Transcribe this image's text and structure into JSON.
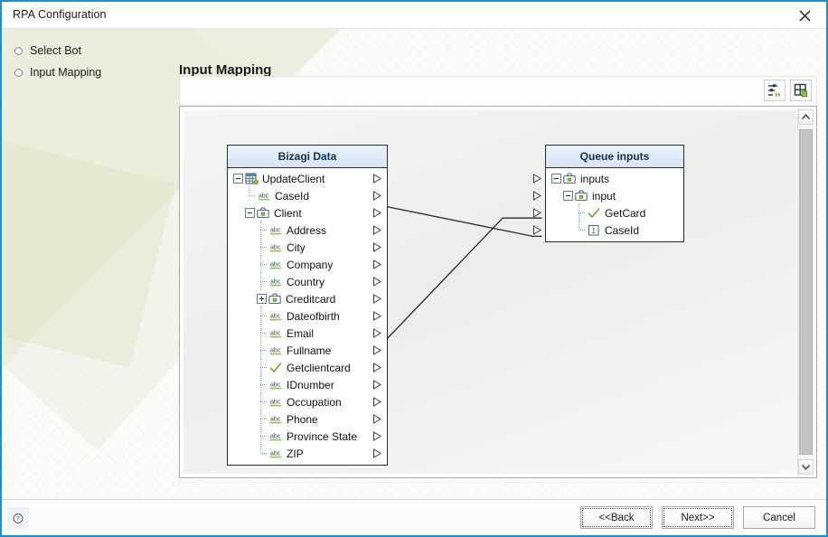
{
  "window": {
    "title": "RPA Configuration",
    "close_icon": "close-icon",
    "accent_color": "#1e90d2"
  },
  "steps": [
    {
      "label": "Select Bot"
    },
    {
      "label": "Input Mapping"
    }
  ],
  "main": {
    "page_title": "Input Mapping",
    "toolbar": [
      {
        "name": "auto-map-button",
        "icon": "auto-map-icon",
        "title": "Auto map"
      },
      {
        "name": "arrange-layout-button",
        "icon": "arrange-layout-icon",
        "title": "Arrange layout"
      }
    ]
  },
  "left_panel": {
    "header": "Bizagi Data",
    "nodes": [
      {
        "label": "UpdateClient",
        "icon": "entity-icon",
        "depth": 0,
        "expander": "minus",
        "arrow": true
      },
      {
        "label": "CaseId",
        "icon": "string-icon",
        "depth": 1,
        "elbow": "last",
        "arrow": true
      },
      {
        "label": "Client",
        "icon": "briefcase-icon",
        "depth": 1,
        "expander": "minus",
        "arrow": true
      },
      {
        "label": "Address",
        "icon": "string-icon",
        "depth": 2,
        "elbow": "thru",
        "arrow": true
      },
      {
        "label": "City",
        "icon": "string-icon",
        "depth": 2,
        "elbow": "thru",
        "arrow": true
      },
      {
        "label": "Company",
        "icon": "string-icon",
        "depth": 2,
        "elbow": "thru",
        "arrow": true
      },
      {
        "label": "Country",
        "icon": "string-icon",
        "depth": 2,
        "elbow": "thru",
        "arrow": true
      },
      {
        "label": "Creditcard",
        "icon": "briefcase-icon",
        "depth": 2,
        "expander": "plus",
        "arrow": true
      },
      {
        "label": "Dateofbirth",
        "icon": "string-icon",
        "depth": 2,
        "elbow": "thru",
        "arrow": true
      },
      {
        "label": "Email",
        "icon": "string-icon",
        "depth": 2,
        "elbow": "thru",
        "arrow": true
      },
      {
        "label": "Fullname",
        "icon": "string-icon",
        "depth": 2,
        "elbow": "thru",
        "arrow": true
      },
      {
        "label": "Getclientcard",
        "icon": "boolean-icon",
        "depth": 2,
        "elbow": "thru",
        "arrow": true
      },
      {
        "label": "IDnumber",
        "icon": "string-icon",
        "depth": 2,
        "elbow": "thru",
        "arrow": true
      },
      {
        "label": "Occupation",
        "icon": "string-icon",
        "depth": 2,
        "elbow": "thru",
        "arrow": true
      },
      {
        "label": "Phone",
        "icon": "string-icon",
        "depth": 2,
        "elbow": "thru",
        "arrow": true
      },
      {
        "label": "Province State",
        "icon": "string-icon",
        "depth": 2,
        "elbow": "thru",
        "arrow": true
      },
      {
        "label": "ZIP",
        "icon": "string-icon",
        "depth": 2,
        "elbow": "last",
        "arrow": true
      }
    ]
  },
  "right_panel": {
    "header": "Queue inputs",
    "nodes": [
      {
        "label": "inputs",
        "icon": "briefcase-icon",
        "depth": 0,
        "expander": "minus",
        "arrow": true
      },
      {
        "label": "input",
        "icon": "briefcase-icon",
        "depth": 1,
        "expander": "minus",
        "arrow": true
      },
      {
        "label": "GetCard",
        "icon": "boolean-icon",
        "depth": 2,
        "elbow": "thru",
        "arrow": true
      },
      {
        "label": "CaseId",
        "icon": "number-icon",
        "depth": 2,
        "elbow": "last",
        "arrow": true
      }
    ]
  },
  "connections": [
    {
      "from": "CaseId",
      "to": "CaseId"
    },
    {
      "from": "Getclientcard",
      "to": "GetCard"
    }
  ],
  "scrollbar": {
    "up_icon": "chevron-up-icon",
    "down_icon": "chevron-down-icon"
  },
  "footer": {
    "help_icon": "help-icon",
    "buttons": [
      {
        "label": "<<Back",
        "name": "back-button",
        "focus": true
      },
      {
        "label": "Next>>",
        "name": "next-button",
        "focus": true
      },
      {
        "label": "Cancel",
        "name": "cancel-button",
        "focus": false
      }
    ]
  }
}
